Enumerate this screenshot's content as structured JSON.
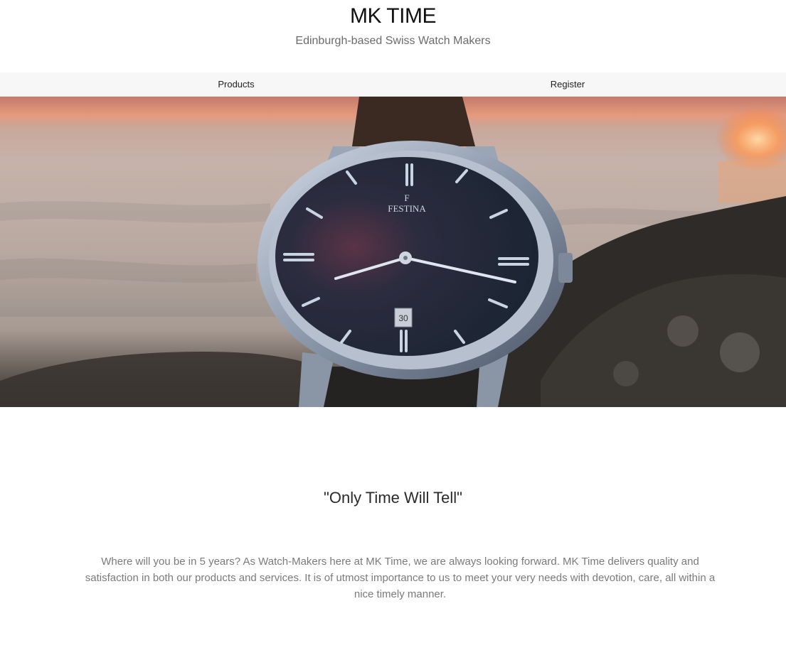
{
  "header": {
    "brand": "MK TIME",
    "tagline": "Edinburgh-based Swiss Watch Makers"
  },
  "nav": {
    "items": [
      {
        "label": "Products"
      },
      {
        "label": "Register"
      }
    ]
  },
  "hero": {
    "watch_brand": "FESTINA",
    "date_window": "30"
  },
  "content": {
    "quote": "\"Only Time Will Tell\"",
    "paragraph": "Where will you be in 5 years? As Watch-Makers here at MK Time, we are always looking forward. MK Time delivers quality and satisfaction in both our products and services. It is of utmost importance to us to meet your very needs with devotion, care, all within a nice timely manner."
  },
  "colors": {
    "nav_background": "#f7f7f7",
    "dial": "#1f2836",
    "text_muted": "#7a7a7a"
  }
}
